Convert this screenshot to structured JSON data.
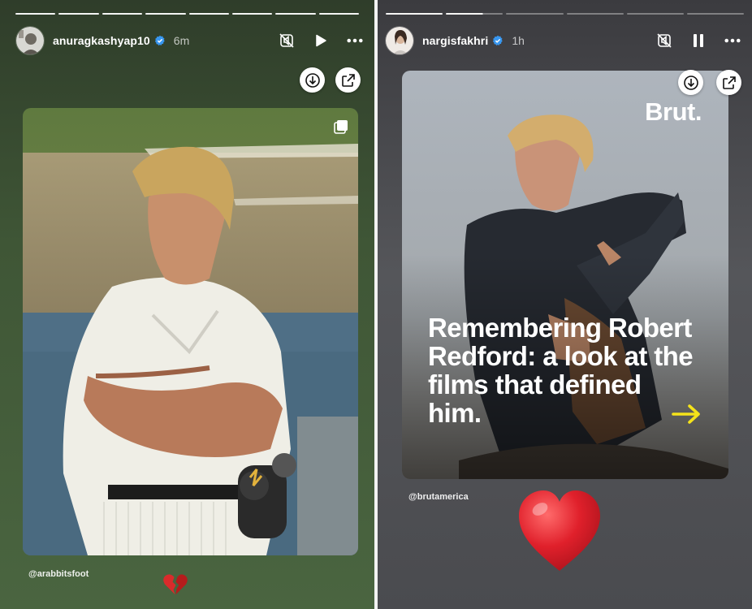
{
  "left_story": {
    "username": "anuragkashyap10",
    "time": "6m",
    "mention": "@arabbitsfoot",
    "progress_total": 8,
    "progress_done": 8,
    "sticker": "broken-heart-emoji"
  },
  "right_story": {
    "username": "nargisfakhri",
    "time": "1h",
    "mention": "@brutamerica",
    "progress_total": 6,
    "progress_done": 2,
    "brand": "Brut.",
    "headline": "Remembering Robert Redford: a look at the films that defined him.",
    "sticker": "red-heart-emoji"
  },
  "icons": {
    "mute": "muted-speaker-icon",
    "play": "play-icon",
    "pause": "pause-icon",
    "more": "more-options-icon",
    "download": "download-icon",
    "share": "share-external-icon",
    "verified": "verified-badge-icon",
    "carousel": "multiple-images-icon",
    "arrow": "arrow-right-icon"
  },
  "colors": {
    "verified_blue": "#3897f0",
    "arrow_yellow": "#f5e31a",
    "heart_red": "#e0202b"
  }
}
